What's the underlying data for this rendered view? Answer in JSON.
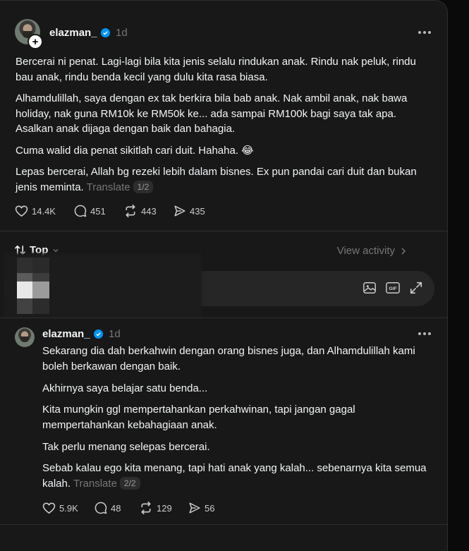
{
  "post1": {
    "username": "elazman_",
    "time": "1d",
    "paragraphs": [
      "Bercerai ni penat. Lagi-lagi bila kita jenis selalu rindukan anak. Rindu nak peluk, rindu bau anak, rindu benda kecil yang dulu kita rasa biasa.",
      "Alhamdulillah, saya dengan ex tak berkira bila bab anak. Nak ambil anak, nak bawa holiday, nak guna RM10k ke RM50k ke... ada sampai RM100k bagi saya tak apa. Asalkan anak dijaga dengan baik dan bahagia.",
      "Cuma walid dia penat sikitlah cari duit. Hahaha. 😂",
      "Lepas bercerai, Allah bg rezeki lebih dalam bisnes. Ex pun pandai cari duit dan bukan jenis meminta."
    ],
    "translate": "Translate",
    "page": "1/2",
    "likes": "14.4K",
    "comments": "451",
    "reposts": "443",
    "shares": "435"
  },
  "sort": {
    "label": "Top",
    "view_activity": "View activity"
  },
  "reply": {
    "placeholder": "",
    "gif": "GIF"
  },
  "post2": {
    "username": "elazman_",
    "time": "1d",
    "paragraphs": [
      "Sekarang dia dah berkahwin dengan orang bisnes juga, dan Alhamdulillah kami boleh berkawan dengan baik.",
      "Akhirnya saya belajar satu benda...",
      "Kita mungkin ggl mempertahankan perkahwinan, tapi jangan gagal mempertahankan kebahagiaan anak.",
      "Tak perlu menang selepas bercerai.",
      "Sebab kalau ego kita menang, tapi hati anak yang kalah... sebenarnya kita semua kalah."
    ],
    "translate": "Translate",
    "page": "2/2",
    "likes": "5.9K",
    "comments": "48",
    "reposts": "129",
    "shares": "56"
  },
  "colors": {
    "background": "#181818",
    "verified": "#0095f6",
    "muted": "#777777"
  }
}
